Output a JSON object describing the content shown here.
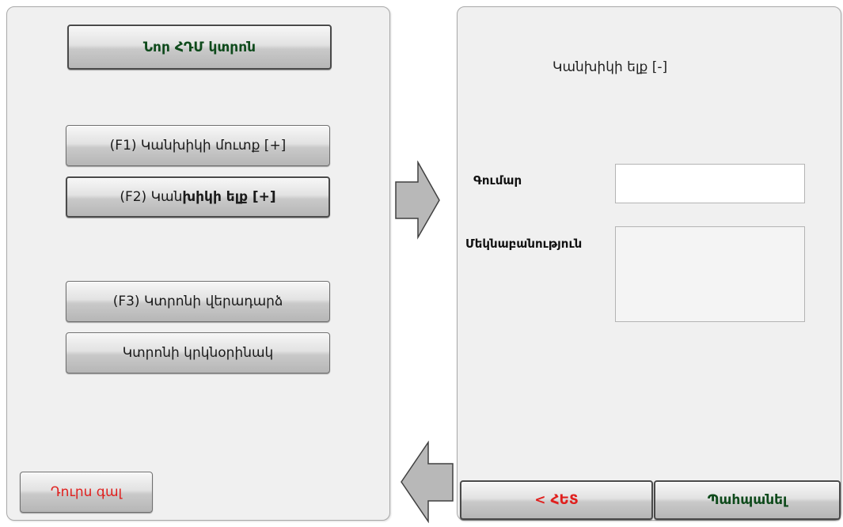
{
  "left_panel": {
    "new_receipt_button": "Նոր ՀԴՄ կտրոն",
    "f1_button_label": "(F1) Կանխիկի մուտք  [+]",
    "f2_button_prefix": "(F2) Կան",
    "f2_button_bold": "խիկի ելք  [+]",
    "f3_button_label": "(F3) Կտրոնի վերադարձ",
    "duplicate_button_label": "Կտրոնի կրկնօրինակ",
    "exit_button_label": "Դուրս գալ"
  },
  "right_panel": {
    "title": "Կանխիկի ելք [-]",
    "amount_label": "Գումար",
    "amount_value": "",
    "description_label": "Մեկնաբանություն",
    "description_value": "",
    "back_button_label": "< ՀԵՏ",
    "save_button_label": "Պահպանել"
  },
  "colors": {
    "panel_bg": "#f0f0f0",
    "accent_green": "#0e4a1b",
    "accent_red": "#e0201e",
    "arrow_fill": "#b8b8b8"
  },
  "icons": {
    "right_arrow": "arrow-right-icon",
    "left_arrow": "arrow-left-icon"
  }
}
